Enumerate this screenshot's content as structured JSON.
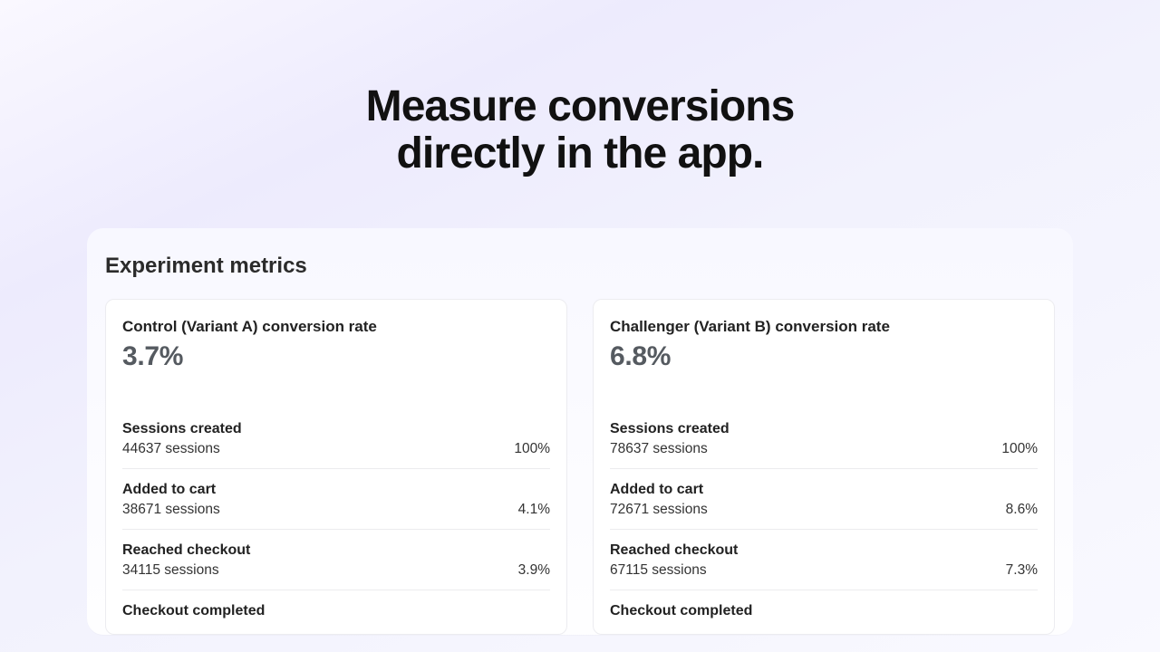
{
  "hero": {
    "line1": "Measure conversions",
    "line2": "directly in the app."
  },
  "panel": {
    "title": "Experiment metrics"
  },
  "variants": [
    {
      "title": "Control (Variant A) conversion rate",
      "rate": "3.7%",
      "rows": [
        {
          "label": "Sessions created",
          "sessions": "44637 sessions",
          "pct": "100%"
        },
        {
          "label": "Added to cart",
          "sessions": "38671 sessions",
          "pct": "4.1%"
        },
        {
          "label": "Reached checkout",
          "sessions": "34115 sessions",
          "pct": "3.9%"
        },
        {
          "label": "Checkout completed",
          "sessions": "",
          "pct": ""
        }
      ]
    },
    {
      "title": "Challenger  (Variant B)  conversion rate",
      "rate": "6.8%",
      "rows": [
        {
          "label": "Sessions created",
          "sessions": "78637 sessions",
          "pct": "100%"
        },
        {
          "label": "Added to cart",
          "sessions": "72671 sessions",
          "pct": "8.6%"
        },
        {
          "label": "Reached checkout",
          "sessions": "67115 sessions",
          "pct": "7.3%"
        },
        {
          "label": "Checkout completed",
          "sessions": "",
          "pct": ""
        }
      ]
    }
  ]
}
